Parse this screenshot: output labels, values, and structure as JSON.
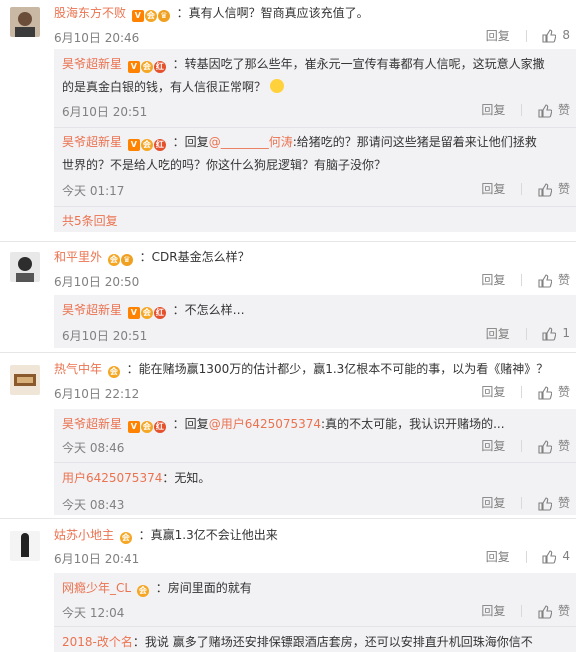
{
  "actions": {
    "reply": "回复",
    "like": "赞"
  },
  "comments": [
    {
      "user": "股海东方不败",
      "text": "：真有人信啊？智商真应该充值了。",
      "time": "6月10日 20:46",
      "likes": "8",
      "replies": [
        {
          "user": "昊爷超新星",
          "text_l1": "：转基因吃了那么些年，崔永元一宣传有毒都有人信呢，这玩意人家撒",
          "text_l2": "的是真金白银的钱，有人信很正常啊？",
          "time": "6月10日 20:51",
          "likes": ""
        },
        {
          "user": "昊爷超新星",
          "prefix": "：回复",
          "mention": "@________何涛",
          "text_l1": ":给猪吃的？那请问这些猪是留着来让他们拯救",
          "text_l2": "世界的？不是给人吃的吗？你这什么狗屁逻辑？有脑子没你？",
          "time": "今天 01:17",
          "likes": ""
        }
      ],
      "more": "共5条回复"
    },
    {
      "user": "和平里外",
      "text": "：CDR基金怎么样？",
      "time": "6月10日 20:50",
      "likes": "",
      "replies": [
        {
          "user": "昊爷超新星",
          "text_l1": "：不怎么样…",
          "time": "6月10日 20:51",
          "likes": "1"
        }
      ]
    },
    {
      "user": "热气中年",
      "text": "：能在赌场赢1300万的估计都少，赢1.3亿根本不可能的事，以为看《赌神》？",
      "time": "6月10日 22:12",
      "likes": "",
      "replies": [
        {
          "user": "昊爷超新星",
          "prefix": "：回复",
          "mention": "@用户6425075374",
          "text_l1": ":真的不太可能，我认识开赌场的...",
          "time": "今天 08:46",
          "likes": ""
        },
        {
          "user": "用户6425075374",
          "text_l1": "：无知。",
          "time": "今天 08:43",
          "likes": ""
        }
      ]
    },
    {
      "user": "姑苏小地主",
      "text": "：真赢1.3亿不会让他出来",
      "time": "6月10日 20:41",
      "likes": "4",
      "replies": [
        {
          "user": "网瘾少年_CL",
          "text_l1": "：房间里面的就有",
          "time": "今天 12:04",
          "likes": ""
        },
        {
          "user": "2018-改个名",
          "text_l1": "：我说 赢多了赌场还安排保镖跟酒店套房，还可以安排直升机回珠海你信不"
        }
      ]
    }
  ]
}
